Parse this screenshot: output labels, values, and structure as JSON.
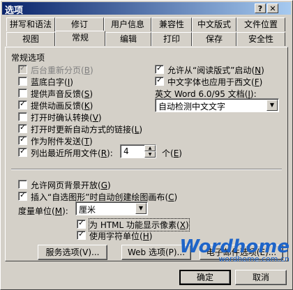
{
  "window": {
    "title": "选项",
    "help_label": "?",
    "close_label": "✕"
  },
  "tabs_back": [
    {
      "label": "拼写和语法"
    },
    {
      "label": "修订"
    },
    {
      "label": "用户信息"
    },
    {
      "label": "兼容性"
    },
    {
      "label": "中文版式"
    },
    {
      "label": "文件位置"
    }
  ],
  "tabs_front": [
    {
      "label": "视图"
    },
    {
      "label": "常规"
    },
    {
      "label": "编辑"
    },
    {
      "label": "打印"
    },
    {
      "label": "保存"
    },
    {
      "label": "安全性"
    }
  ],
  "active_tab": "常规",
  "group_label": "常规选项",
  "left_options": [
    {
      "label": "后台重新分页",
      "key": "B",
      "checked": true,
      "disabled": true
    },
    {
      "label": "蓝底白字",
      "key": "I",
      "checked": false
    },
    {
      "label": "提供声音反馈",
      "key": "S",
      "checked": false
    },
    {
      "label": "提供动画反馈",
      "key": "K",
      "checked": true
    },
    {
      "label": "打开时确认转换",
      "key": "V",
      "checked": false
    },
    {
      "label": "打开时更新自动方式的链接",
      "key": "L",
      "checked": true
    },
    {
      "label": "作为附件发送",
      "key": "T",
      "checked": true
    },
    {
      "label": "列出最近所用文件",
      "key": "R",
      "checked": true
    }
  ],
  "right_options": [
    {
      "label": "允许从“阅读版式”启动",
      "key": "N",
      "checked": true
    },
    {
      "label": "中文字体也应用于西文",
      "key": "F",
      "checked": true
    }
  ],
  "recent_files": {
    "count": "4",
    "unit": "个",
    "unit_key": "E"
  },
  "english_word": {
    "label": "英文 Word 6.0/95 文档",
    "key": "I",
    "value": "自动检测中文文字"
  },
  "lower_options": [
    {
      "label": "允许网页背景开放",
      "key": "G",
      "checked": false
    },
    {
      "label": "插入“自选图形”时自动创建绘图画布",
      "key": "C",
      "checked": true
    }
  ],
  "units": {
    "label": "度量单位",
    "key": "M",
    "value": "厘米"
  },
  "sub_options": [
    {
      "label": "为 HTML 功能显示像素",
      "key": "X",
      "checked": true
    },
    {
      "label": "使用字符单位",
      "key": "H",
      "checked": true
    }
  ],
  "buttons": {
    "service": "服务选项(V)...",
    "web": "Web 选项(P)...",
    "email": "电子邮件选项(E)...",
    "ok": "确定",
    "cancel": "取消"
  },
  "watermark": {
    "brand": "Wordhome",
    "url": "wordhome.com.cn"
  }
}
